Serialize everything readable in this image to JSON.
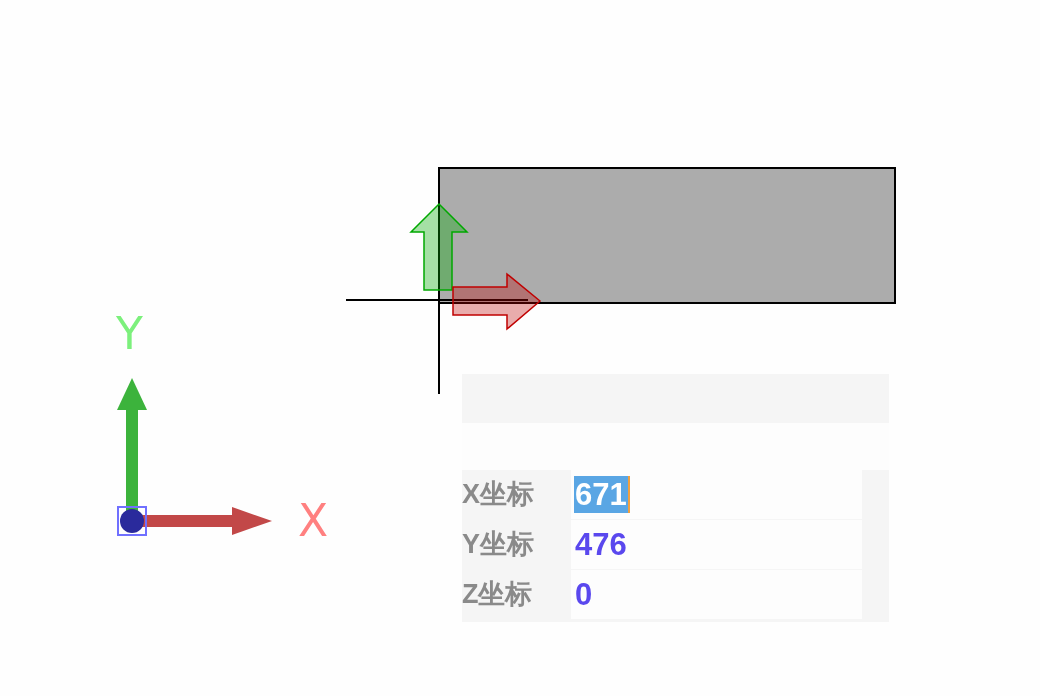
{
  "ucs_icon": {
    "x_label": "X",
    "y_label": "Y"
  },
  "dynamic_input": {
    "fields": [
      {
        "label": "X坐标",
        "value": "671",
        "selected": true
      },
      {
        "label": "Y坐标",
        "value": "476",
        "selected": false
      },
      {
        "label": "Z坐标",
        "value": "0",
        "selected": false
      }
    ]
  }
}
